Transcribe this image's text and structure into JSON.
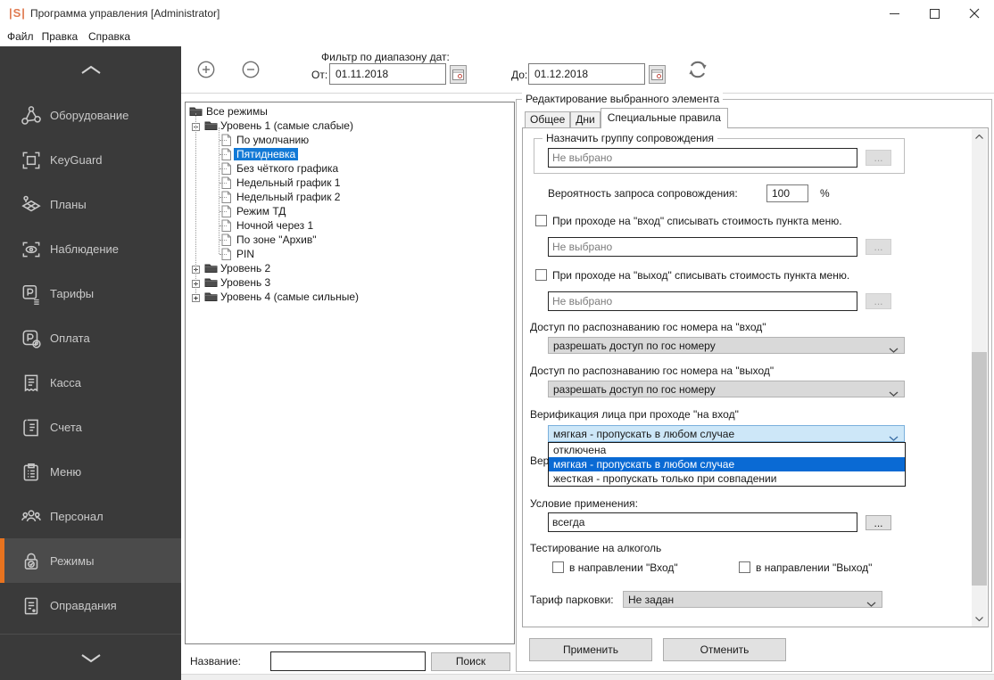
{
  "window": {
    "app_icon": "|S|",
    "title": "Программа управления [Administrator]"
  },
  "menu": {
    "items": [
      "Файл",
      "Правка",
      "Справка"
    ]
  },
  "toolbar": {
    "filter_label": "Фильтр по диапазону дат:",
    "from_label": "От:",
    "from_value": "01.11.2018",
    "to_label": "До:",
    "to_value": "01.12.2018"
  },
  "sidebar": {
    "accent_color": "#e8731f",
    "items": [
      {
        "label": "Оборудование",
        "icon": "equipment-icon",
        "selected": false
      },
      {
        "label": "KeyGuard",
        "icon": "keyguard-icon",
        "selected": false
      },
      {
        "label": "Планы",
        "icon": "plans-icon",
        "selected": false
      },
      {
        "label": "Наблюдение",
        "icon": "monitoring-icon",
        "selected": false
      },
      {
        "label": "Тарифы",
        "icon": "tariffs-icon",
        "selected": false
      },
      {
        "label": "Оплата",
        "icon": "payment-icon",
        "selected": false
      },
      {
        "label": "Касса",
        "icon": "cashier-icon",
        "selected": false
      },
      {
        "label": "Счета",
        "icon": "bills-icon",
        "selected": false
      },
      {
        "label": "Меню",
        "icon": "menu-icon",
        "selected": false
      },
      {
        "label": "Персонал",
        "icon": "staff-icon",
        "selected": false
      },
      {
        "label": "Режимы",
        "icon": "modes-icon",
        "selected": true
      },
      {
        "label": "Оправдания",
        "icon": "excuses-icon",
        "selected": false
      }
    ]
  },
  "tree": {
    "items": [
      {
        "label": "Все режимы",
        "icon": "folder",
        "level": 0,
        "expand": "none",
        "selected": false
      },
      {
        "label": "Уровень 1 (самые слабые)",
        "icon": "folder",
        "level": 1,
        "expand": "minus",
        "selected": false
      },
      {
        "label": "По умолчанию",
        "icon": "page",
        "level": 2,
        "expand": "none",
        "selected": false
      },
      {
        "label": "Пятидневка",
        "icon": "page",
        "level": 2,
        "expand": "none",
        "selected": true
      },
      {
        "label": "Без чёткого графика",
        "icon": "page",
        "level": 2,
        "expand": "none",
        "selected": false
      },
      {
        "label": "Недельный график 1",
        "icon": "page",
        "level": 2,
        "expand": "none",
        "selected": false
      },
      {
        "label": "Недельный график 2",
        "icon": "page",
        "level": 2,
        "expand": "none",
        "selected": false
      },
      {
        "label": "Режим ТД",
        "icon": "page",
        "level": 2,
        "expand": "none",
        "selected": false
      },
      {
        "label": "Ночной через 1",
        "icon": "page",
        "level": 2,
        "expand": "none",
        "selected": false
      },
      {
        "label": "По зоне \"Архив\"",
        "icon": "page",
        "level": 2,
        "expand": "none",
        "selected": false
      },
      {
        "label": "PIN",
        "icon": "page",
        "level": 2,
        "expand": "none",
        "selected": false
      },
      {
        "label": "Уровень 2",
        "icon": "folder",
        "level": 1,
        "expand": "plus",
        "selected": false
      },
      {
        "label": "Уровень 3",
        "icon": "folder",
        "level": 1,
        "expand": "plus",
        "selected": false
      },
      {
        "label": "Уровень 4 (самые сильные)",
        "icon": "folder",
        "level": 1,
        "expand": "plus",
        "selected": false
      }
    ]
  },
  "search": {
    "label": "Название:",
    "value": "",
    "button": "Поиск"
  },
  "editor": {
    "group_title": "Редактирование выбранного элемента",
    "tabs": [
      {
        "label": "Общее",
        "active": false
      },
      {
        "label": "Дни",
        "active": false
      },
      {
        "label": "Специальные правила",
        "active": true
      }
    ],
    "escort_group": {
      "title": "Назначить группу сопровождения",
      "value": "Не выбрано",
      "browse": "..."
    },
    "probability": {
      "label": "Вероятность запроса сопровождения:",
      "value": "100",
      "unit": "%"
    },
    "entry_menu": {
      "label": "При проходе на \"вход\" списывать стоимость пункта меню.",
      "checked": false,
      "value": "Не выбрано",
      "browse": "..."
    },
    "exit_menu": {
      "label": "При проходе на \"выход\" списывать стоимость пункта меню.",
      "checked": false,
      "value": "Не выбрано",
      "browse": "..."
    },
    "plate_in": {
      "label": "Доступ по распознаванию гос номера на \"вход\"",
      "value": "разрешать доступ по гос номеру"
    },
    "plate_out": {
      "label": "Доступ по распознаванию гос номера на \"выход\"",
      "value": "разрешать доступ по гос номеру"
    },
    "face_in": {
      "label": "Верификация лица при проходе \"на вход\"",
      "value": "мягкая - пропускать в любом случае",
      "options": [
        "отключена",
        "мягкая - пропускать в любом случае",
        "жесткая - пропускать только при совпадении"
      ],
      "selected_index": 1
    },
    "hidden_label": "Вери",
    "condition": {
      "label": "Условие применения:",
      "value": "всегда",
      "browse": "..."
    },
    "alcohol": {
      "title": "Тестирование на алкоголь",
      "checkbox_in": "в направлении \"Вход\"",
      "checkbox_out": "в направлении \"Выход\""
    },
    "parking": {
      "label": "Тариф парковки:",
      "value": "Не задан"
    },
    "apply_label": "Применить",
    "cancel_label": "Отменить"
  }
}
